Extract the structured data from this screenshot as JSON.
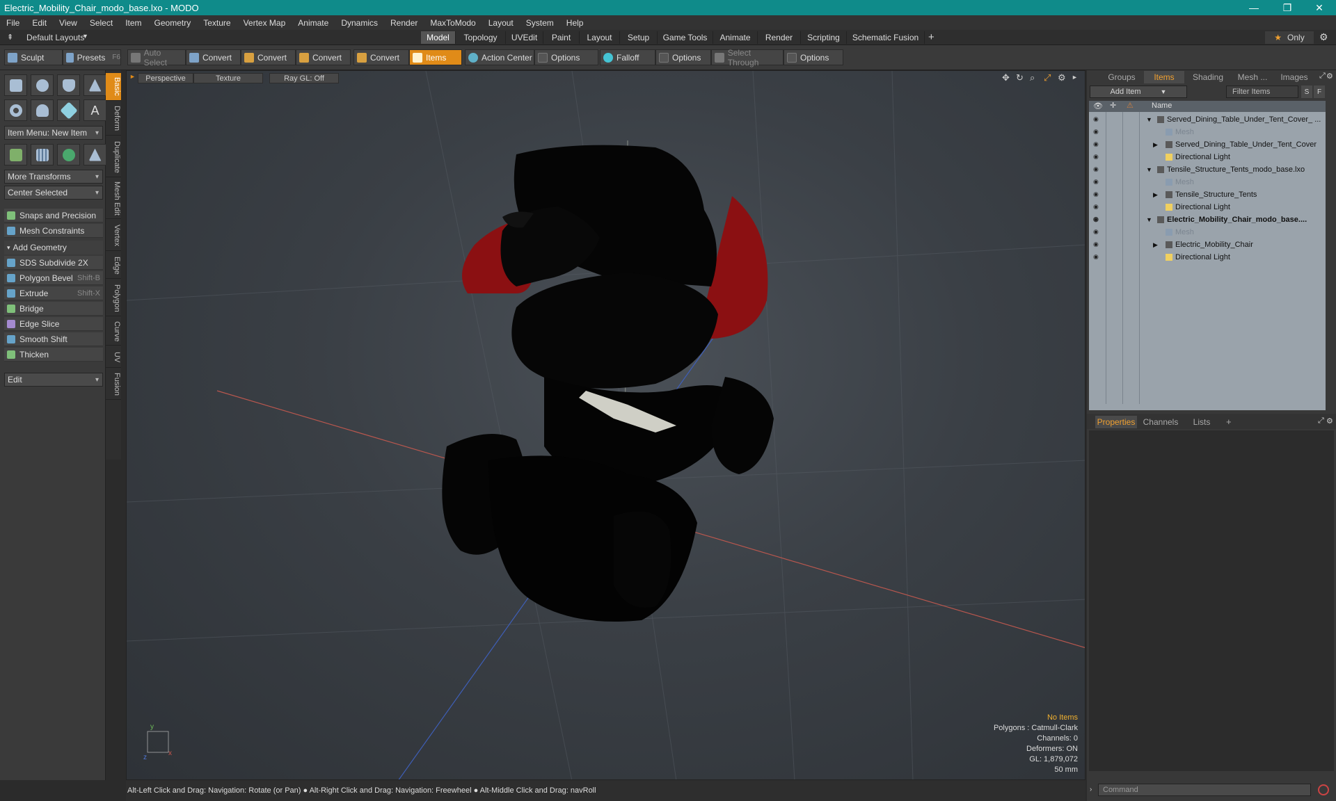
{
  "window": {
    "title": "Electric_Mobility_Chair_modo_base.lxo - MODO"
  },
  "menu": [
    "File",
    "Edit",
    "View",
    "Select",
    "Item",
    "Geometry",
    "Texture",
    "Vertex Map",
    "Animate",
    "Dynamics",
    "Render",
    "MaxToModo",
    "Layout",
    "System",
    "Help"
  ],
  "layouts": {
    "label": "Default Layouts",
    "tabs": [
      "Model",
      "Topology",
      "UVEdit",
      "Paint",
      "Layout",
      "Setup",
      "Game Tools",
      "Animate",
      "Render",
      "Scripting",
      "Schematic Fusion"
    ],
    "only": "Only"
  },
  "toolbar": {
    "sculpt": "Sculpt",
    "presets": "Presets",
    "presets_key": "F6",
    "auto_select": "Auto Select",
    "convert": "Convert",
    "items": "Items",
    "action_center": "Action Center",
    "options": "Options",
    "falloff": "Falloff",
    "select_through": "Select Through"
  },
  "left": {
    "item_menu": "Item Menu: New Item",
    "more_transforms": "More Transforms",
    "center_selected": "Center Selected",
    "snaps": "Snaps and Precision",
    "mesh_constraints": "Mesh Constraints",
    "add_geometry": "Add Geometry",
    "sds": "SDS Subdivide 2X",
    "polygon_bevel": "Polygon Bevel",
    "polygon_bevel_key": "Shift-B",
    "extrude": "Extrude",
    "extrude_key": "Shift-X",
    "bridge": "Bridge",
    "edge_slice": "Edge Slice",
    "smooth_shift": "Smooth Shift",
    "thicken": "Thicken",
    "edit": "Edit"
  },
  "vtabs": [
    "Basic",
    "Deform",
    "Duplicate",
    "Mesh Edit",
    "Vertex",
    "Edge",
    "Polygon",
    "Curve",
    "UV",
    "Fusion"
  ],
  "viewport": {
    "view": "Perspective",
    "shading": "Texture",
    "raygl": "Ray GL: Off",
    "hud": {
      "no_items": "No Items",
      "polygons": "Polygons : Catmull-Clark",
      "channels": "Channels: 0",
      "deformers": "Deformers: ON",
      "gl": "GL: 1,879,072",
      "focal": "50 mm"
    }
  },
  "status": {
    "text": "Alt-Left Click and Drag: Navigation: Rotate (or Pan) ● Alt-Right Click and Drag: Navigation: Freewheel ● Alt-Middle Click and Drag: navRoll"
  },
  "right": {
    "tabs": [
      "Groups",
      "Items",
      "Shading",
      "Mesh ...",
      "Images"
    ],
    "add_item": "Add Item",
    "filter": "Filter Items",
    "s": "S",
    "f": "F",
    "name_col": "Name",
    "items": [
      {
        "label": "Served_Dining_Table_Under_Tent_Cover_ ...",
        "indent": 0,
        "style": ""
      },
      {
        "label": "Mesh",
        "indent": 1,
        "style": "dim"
      },
      {
        "label": "Served_Dining_Table_Under_Tent_Cover",
        "indent": 1,
        "style": ""
      },
      {
        "label": "Directional Light",
        "indent": 1,
        "style": ""
      },
      {
        "label": "Tensile_Structure_Tents_modo_base.lxo",
        "indent": 0,
        "style": ""
      },
      {
        "label": "Mesh",
        "indent": 1,
        "style": "dim"
      },
      {
        "label": "Tensile_Structure_Tents",
        "indent": 1,
        "style": ""
      },
      {
        "label": "Directional Light",
        "indent": 1,
        "style": ""
      },
      {
        "label": "Electric_Mobility_Chair_modo_base....",
        "indent": 0,
        "style": "bold"
      },
      {
        "label": "Mesh",
        "indent": 1,
        "style": "dim"
      },
      {
        "label": "Electric_Mobility_Chair",
        "indent": 1,
        "style": ""
      },
      {
        "label": "Directional Light",
        "indent": 1,
        "style": ""
      }
    ],
    "ptabs": [
      "Properties",
      "Channels",
      "Lists"
    ],
    "command": "Command"
  }
}
